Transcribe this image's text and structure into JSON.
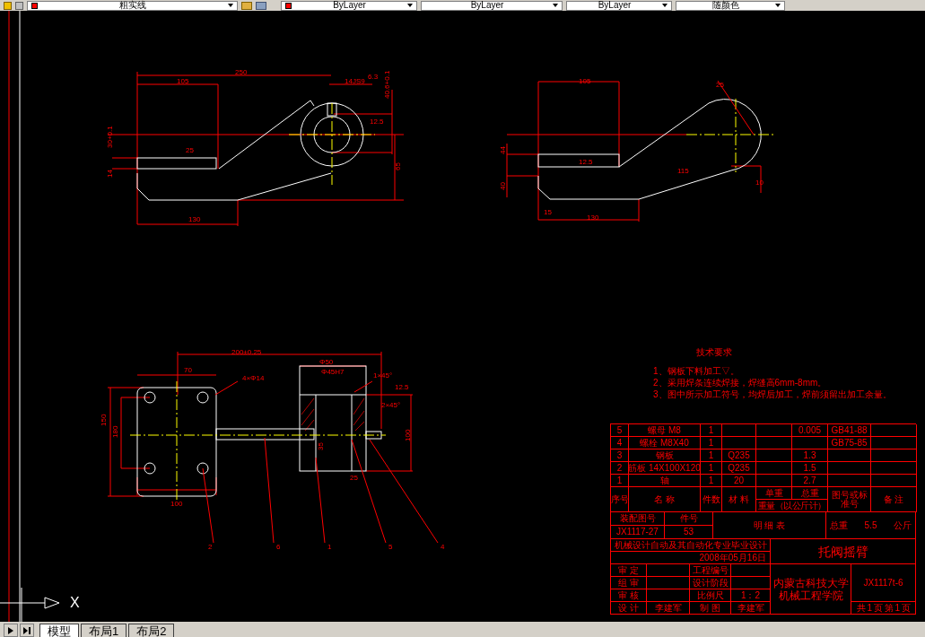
{
  "toolbar": {
    "layer": "粗实线",
    "color_setting": "ByLayer",
    "linetype": "ByLayer",
    "lineweight": "ByLayer",
    "plot_style": "随颜色"
  },
  "dimension_labels": [
    "250",
    "105",
    "14JS9",
    "6.3",
    "40.6+0.1",
    "12.5",
    "25",
    "30+0.1",
    "14",
    "65",
    "130",
    "105",
    "25",
    "12.5",
    "115",
    "130",
    "15",
    "10",
    "44",
    "40",
    "200±0.25",
    "70",
    "4×Φ14",
    "150",
    "180",
    "100",
    "Φ50",
    "Φ45H7",
    "1×45°",
    "12.5",
    "2×45°",
    "100",
    "35",
    "25",
    "2",
    "6",
    "1",
    "5",
    "4"
  ],
  "technical_requirements": {
    "title": "技术要求",
    "items": [
      "1、钢板下料加工▽。",
      "2、采用焊条连续焊接，焊缝高6mm-8mm。",
      "3、图中所示加工符号，均焊后加工，焊前须留出加工余量。"
    ]
  },
  "parts_list": {
    "rows": [
      {
        "no": "5",
        "name": "螺母 M8",
        "qty": "1",
        "material": "",
        "unit_weight": "",
        "total_weight": "0.005",
        "standard": "GB41-88",
        "note": ""
      },
      {
        "no": "4",
        "name": "螺栓 M8X40",
        "qty": "1",
        "material": "",
        "unit_weight": "",
        "total_weight": "",
        "standard": "GB75-85",
        "note": ""
      },
      {
        "no": "3",
        "name": "钢板",
        "qty": "1",
        "material": "Q235",
        "unit_weight": "",
        "total_weight": "1.3",
        "standard": "",
        "note": ""
      },
      {
        "no": "2",
        "name": "筋板 14X100X120",
        "qty": "1",
        "material": "Q235",
        "unit_weight": "",
        "total_weight": "1.5",
        "standard": "",
        "note": ""
      },
      {
        "no": "1",
        "name": "轴",
        "qty": "1",
        "material": "20",
        "unit_weight": "",
        "total_weight": "2.7",
        "standard": "",
        "note": ""
      }
    ],
    "header": {
      "no": "序号",
      "name": "名 称",
      "qty": "件数",
      "material": "材 料",
      "unit_weight": "单重",
      "total_weight": "总重",
      "weight_group": "重量（以公斤计）",
      "standard": "图号或标准号",
      "note": "备 注"
    },
    "assembly_label": "装配图号",
    "part_no_label": "件号",
    "assembly_no": "JX1117-27",
    "part_no": "53",
    "table_title": "明 细 表",
    "total_label": "总重",
    "total_value": "5.5",
    "total_unit": "公斤"
  },
  "title_block": {
    "project": "机械设计自动及其自动化专业毕业设计",
    "date": "2008年05月16日",
    "drawing_title": "托阀摇臂",
    "rows": [
      {
        "label": "审 定",
        "value": "",
        "label2": "工程编号",
        "value2": ""
      },
      {
        "label": "组 审",
        "value": "",
        "label2": "设计阶段",
        "value2": ""
      },
      {
        "label": "审 核",
        "value": "",
        "label2": "比例尺",
        "value2": "1：2"
      },
      {
        "label": "设 计",
        "value": "李建军",
        "label2": "制 图",
        "value2": "李建军"
      }
    ],
    "school": "内蒙古科技大学",
    "department": "机械工程学院",
    "drawing_no": "JX1117t-6",
    "sheet": "共 1 页 第 1 页"
  },
  "ucs_axis_label": "X",
  "layout_tabs": [
    {
      "label": "模型",
      "selected": true
    },
    {
      "label": "布局1",
      "selected": false
    },
    {
      "label": "布局2",
      "selected": false
    }
  ]
}
